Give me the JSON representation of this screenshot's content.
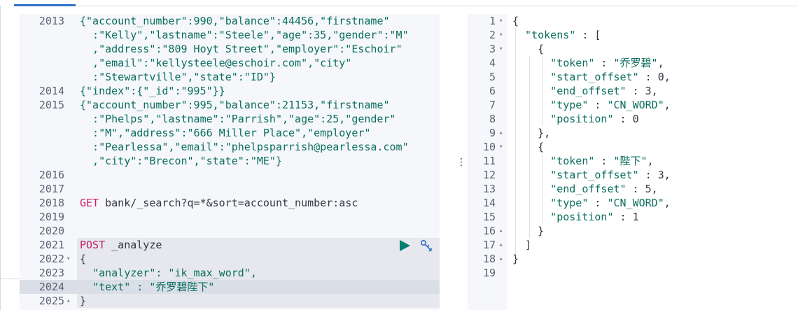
{
  "toolbar": {
    "run_icon": "play-icon",
    "settings_icon": "wrench-icon"
  },
  "colors": {
    "keyword": "#c6206a",
    "string": "#0b6e5e",
    "text": "#343741",
    "line_number": "#5b6170",
    "active_tab": "#2f6fc9"
  },
  "left_editor": {
    "lines": [
      {
        "n": "2013",
        "fold": "",
        "parts": [
          {
            "t": "{\"account_number\":990,\"balance\":44456,\"firstname\"",
            "c": "str"
          }
        ]
      },
      {
        "n": "",
        "fold": "",
        "parts": [
          {
            "t": "  :\"Kelly\",\"lastname\":\"Steele\",\"age\":35,\"gender\":\"M\"",
            "c": "str"
          }
        ]
      },
      {
        "n": "",
        "fold": "",
        "parts": [
          {
            "t": "  ,\"address\":\"809 Hoyt Street\",\"employer\":\"Eschoir\"",
            "c": "str"
          }
        ]
      },
      {
        "n": "",
        "fold": "",
        "parts": [
          {
            "t": "  ,\"email\":\"kellysteele@eschoir.com\",\"city\"",
            "c": "str"
          }
        ]
      },
      {
        "n": "",
        "fold": "",
        "parts": [
          {
            "t": "  :\"Stewartville\",\"state\":\"ID\"}",
            "c": "str"
          }
        ]
      },
      {
        "n": "2014",
        "fold": "",
        "parts": [
          {
            "t": "{\"index\":{\"_id\":\"995\"}}",
            "c": "str"
          }
        ]
      },
      {
        "n": "2015",
        "fold": "",
        "parts": [
          {
            "t": "{\"account_number\":995,\"balance\":21153,\"firstname\"",
            "c": "str"
          }
        ]
      },
      {
        "n": "",
        "fold": "",
        "parts": [
          {
            "t": "  :\"Phelps\",\"lastname\":\"Parrish\",\"age\":25,\"gender\"",
            "c": "str"
          }
        ]
      },
      {
        "n": "",
        "fold": "",
        "parts": [
          {
            "t": "  :\"M\",\"address\":\"666 Miller Place\",\"employer\"",
            "c": "str"
          }
        ]
      },
      {
        "n": "",
        "fold": "",
        "parts": [
          {
            "t": "  :\"Pearlessa\",\"email\":\"phelpsparrish@pearlessa.com\"",
            "c": "str"
          }
        ]
      },
      {
        "n": "",
        "fold": "",
        "parts": [
          {
            "t": "  ,\"city\":\"Brecon\",\"state\":\"ME\"}",
            "c": "str"
          }
        ]
      },
      {
        "n": "2016",
        "fold": "",
        "parts": []
      },
      {
        "n": "2017",
        "fold": "",
        "parts": []
      },
      {
        "n": "2018",
        "fold": "",
        "parts": [
          {
            "t": "GET",
            "c": "kw"
          },
          {
            "t": " bank/_search?q=*&sort=account_number:asc",
            "c": "plain"
          }
        ]
      },
      {
        "n": "2019",
        "fold": "",
        "parts": []
      },
      {
        "n": "2020",
        "fold": "",
        "parts": []
      },
      {
        "n": "2021",
        "fold": "",
        "parts": [
          {
            "t": "POST",
            "c": "kw"
          },
          {
            "t": " _analyze",
            "c": "plain"
          }
        ]
      },
      {
        "n": "2022",
        "fold": "▾",
        "parts": [
          {
            "t": "{",
            "c": "plain"
          }
        ]
      },
      {
        "n": "2023",
        "fold": "",
        "parts": [
          {
            "t": "  \"analyzer\": \"ik_max_word\",",
            "c": "str"
          }
        ]
      },
      {
        "n": "2024",
        "fold": "",
        "parts": [
          {
            "t": "  \"text\" : \"乔罗碧陛下\"",
            "c": "str"
          }
        ]
      },
      {
        "n": "2025",
        "fold": "▴",
        "parts": [
          {
            "t": "}",
            "c": "plain"
          }
        ]
      }
    ]
  },
  "right_editor": {
    "lines": [
      {
        "n": "1",
        "fold": "▾",
        "parts": [
          {
            "t": "{",
            "c": "plain"
          }
        ]
      },
      {
        "n": "2",
        "fold": "▾",
        "parts": [
          {
            "t": "  \"tokens\"",
            "c": "str"
          },
          {
            "t": " : [",
            "c": "plain"
          }
        ]
      },
      {
        "n": "3",
        "fold": "▾",
        "parts": [
          {
            "t": "    {",
            "c": "plain"
          }
        ]
      },
      {
        "n": "4",
        "fold": "",
        "parts": [
          {
            "t": "      \"token\"",
            "c": "str"
          },
          {
            "t": " : ",
            "c": "plain"
          },
          {
            "t": "\"乔罗碧\"",
            "c": "str"
          },
          {
            "t": ",",
            "c": "plain"
          }
        ]
      },
      {
        "n": "5",
        "fold": "",
        "parts": [
          {
            "t": "      \"start_offset\"",
            "c": "str"
          },
          {
            "t": " : 0,",
            "c": "plain"
          }
        ]
      },
      {
        "n": "6",
        "fold": "",
        "parts": [
          {
            "t": "      \"end_offset\"",
            "c": "str"
          },
          {
            "t": " : 3,",
            "c": "plain"
          }
        ]
      },
      {
        "n": "7",
        "fold": "",
        "parts": [
          {
            "t": "      \"type\"",
            "c": "str"
          },
          {
            "t": " : ",
            "c": "plain"
          },
          {
            "t": "\"CN_WORD\"",
            "c": "str"
          },
          {
            "t": ",",
            "c": "plain"
          }
        ]
      },
      {
        "n": "8",
        "fold": "",
        "parts": [
          {
            "t": "      \"position\"",
            "c": "str"
          },
          {
            "t": " : 0",
            "c": "plain"
          }
        ]
      },
      {
        "n": "9",
        "fold": "▴",
        "parts": [
          {
            "t": "    },",
            "c": "plain"
          }
        ]
      },
      {
        "n": "10",
        "fold": "▾",
        "parts": [
          {
            "t": "    {",
            "c": "plain"
          }
        ]
      },
      {
        "n": "11",
        "fold": "",
        "parts": [
          {
            "t": "      \"token\"",
            "c": "str"
          },
          {
            "t": " : ",
            "c": "plain"
          },
          {
            "t": "\"陛下\"",
            "c": "str"
          },
          {
            "t": ",",
            "c": "plain"
          }
        ]
      },
      {
        "n": "12",
        "fold": "",
        "parts": [
          {
            "t": "      \"start_offset\"",
            "c": "str"
          },
          {
            "t": " : 3,",
            "c": "plain"
          }
        ]
      },
      {
        "n": "13",
        "fold": "",
        "parts": [
          {
            "t": "      \"end_offset\"",
            "c": "str"
          },
          {
            "t": " : 5,",
            "c": "plain"
          }
        ]
      },
      {
        "n": "14",
        "fold": "",
        "parts": [
          {
            "t": "      \"type\"",
            "c": "str"
          },
          {
            "t": " : ",
            "c": "plain"
          },
          {
            "t": "\"CN_WORD\"",
            "c": "str"
          },
          {
            "t": ",",
            "c": "plain"
          }
        ]
      },
      {
        "n": "15",
        "fold": "",
        "parts": [
          {
            "t": "      \"position\"",
            "c": "str"
          },
          {
            "t": " : 1",
            "c": "plain"
          }
        ]
      },
      {
        "n": "16",
        "fold": "▴",
        "parts": [
          {
            "t": "    }",
            "c": "plain"
          }
        ]
      },
      {
        "n": "17",
        "fold": "▴",
        "parts": [
          {
            "t": "  ]",
            "c": "plain"
          }
        ]
      },
      {
        "n": "18",
        "fold": "▴",
        "parts": [
          {
            "t": "}",
            "c": "plain"
          }
        ]
      },
      {
        "n": "19",
        "fold": "",
        "parts": []
      }
    ]
  },
  "divider": {
    "glyph": "⋮"
  }
}
